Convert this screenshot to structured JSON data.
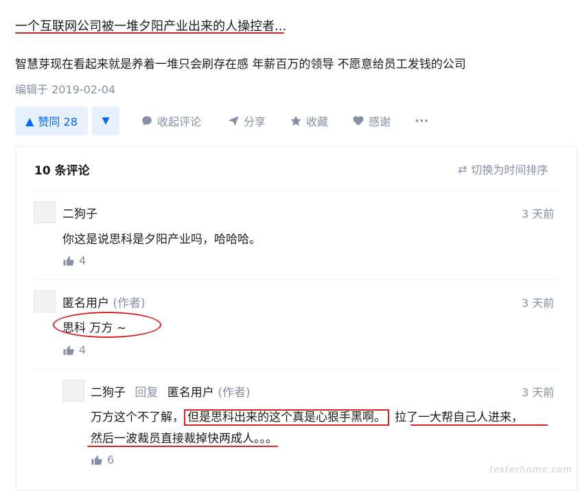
{
  "answer": {
    "intro": "一个互联网公司被一堆夕阳产业出来的人操控者...",
    "body": "智慧芽现在看起来就是养着一堆只会刷存在感 年薪百万的领导 不愿意给员工发钱的公司",
    "edited": "编辑于 2019-02-04"
  },
  "actions": {
    "upvote": "赞同 28",
    "collapse_comments": "收起评论",
    "share": "分享",
    "favorite": "收藏",
    "thanks": "感谢",
    "more": "···"
  },
  "comments_panel": {
    "count_label": "10 条评论",
    "sort_label": "切换为时间排序"
  },
  "comments": [
    {
      "author": "二狗子",
      "time": "3 天前",
      "text": "你这是说思科是夕阳产业吗，哈哈哈。",
      "likes": "4"
    },
    {
      "author": "匿名用户",
      "author_tag": "(作者)",
      "time": "3 天前",
      "text": "思科 万方 ~",
      "likes": "4"
    },
    {
      "author": "二狗子",
      "reply_word": "回复",
      "reply_to": "匿名用户",
      "reply_to_tag": "(作者)",
      "time": "3 天前",
      "text_a": "万方这个不了解，",
      "text_b": "但是思科出来的这个真是心狠手黑啊。",
      "text_c": "拉了一大帮自己人进来，",
      "text_d": "然后一波裁员直接裁掉快两成人。。。",
      "likes": "6"
    }
  ],
  "watermark": "testerhome.com",
  "colors": {
    "accent": "#0066ff",
    "accent_bg": "#e8f2ff",
    "muted": "#8590a6",
    "annotation": "#e02020"
  }
}
